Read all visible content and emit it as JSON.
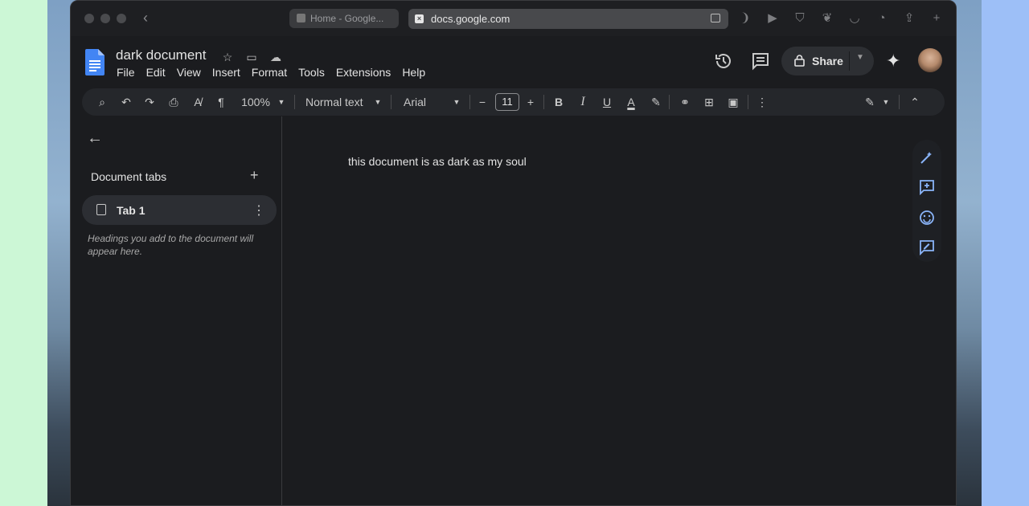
{
  "browser": {
    "inactive_tab": "Home - Google...",
    "active_tab_url": "docs.google.com"
  },
  "doc": {
    "title": "dark document",
    "menu": [
      "File",
      "Edit",
      "View",
      "Insert",
      "Format",
      "Tools",
      "Extensions",
      "Help"
    ],
    "share_label": "Share"
  },
  "toolbar": {
    "zoom": "100%",
    "style": "Normal text",
    "font": "Arial",
    "font_size": "11",
    "bold": "B",
    "italic": "I",
    "underline": "U",
    "text_color": "A"
  },
  "sidebar": {
    "heading": "Document tabs",
    "tab_label": "Tab 1",
    "hint": "Headings you add to the document will appear here."
  },
  "body": {
    "text": "this document is as dark as my soul"
  },
  "colors": {
    "background": "#1b1c1f",
    "accent": "#8ab4f8",
    "docs_blue": "#4285f4"
  }
}
